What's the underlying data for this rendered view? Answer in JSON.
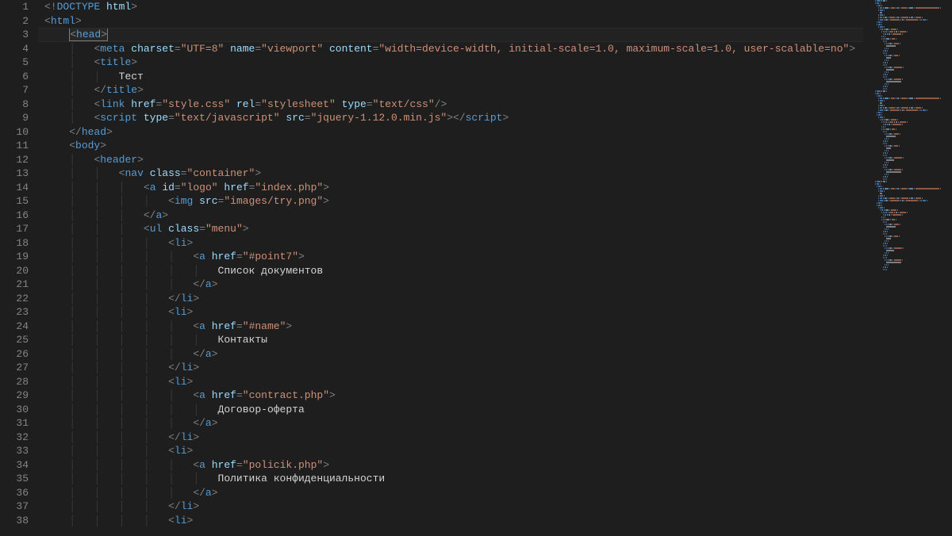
{
  "lineCount": 38,
  "highlightedLine": 3,
  "code": {
    "indentUnit": "    ",
    "lines": [
      {
        "n": 1,
        "indent": 0,
        "tokens": [
          {
            "t": "<!",
            "c": "pun"
          },
          {
            "t": "DOCTYPE",
            "c": "doctype"
          },
          {
            "t": " ",
            "c": "txt"
          },
          {
            "t": "html",
            "c": "attr"
          },
          {
            "t": ">",
            "c": "pun"
          }
        ]
      },
      {
        "n": 2,
        "indent": 0,
        "tokens": [
          {
            "t": "<",
            "c": "pun"
          },
          {
            "t": "html",
            "c": "tag"
          },
          {
            "t": ">",
            "c": "pun"
          }
        ]
      },
      {
        "n": 3,
        "indent": 1,
        "tokens": [
          {
            "t": "<",
            "c": "pun",
            "boxStart": true
          },
          {
            "t": "head",
            "c": "tag"
          },
          {
            "t": ">",
            "c": "pun",
            "boxEnd": true
          }
        ]
      },
      {
        "n": 4,
        "indent": 2,
        "tokens": [
          {
            "t": "<",
            "c": "pun"
          },
          {
            "t": "meta",
            "c": "tag"
          },
          {
            "t": " ",
            "c": "txt"
          },
          {
            "t": "charset",
            "c": "attr"
          },
          {
            "t": "=",
            "c": "pun"
          },
          {
            "t": "\"UTF=8\"",
            "c": "str"
          },
          {
            "t": " ",
            "c": "txt"
          },
          {
            "t": "name",
            "c": "attr"
          },
          {
            "t": "=",
            "c": "pun"
          },
          {
            "t": "\"viewport\"",
            "c": "str"
          },
          {
            "t": " ",
            "c": "txt"
          },
          {
            "t": "content",
            "c": "attr"
          },
          {
            "t": "=",
            "c": "pun"
          },
          {
            "t": "\"width=device-width, initial-scale=1.0, maximum-scale=1.0, user-scalable=no\"",
            "c": "str"
          },
          {
            "t": ">",
            "c": "pun"
          }
        ]
      },
      {
        "n": 5,
        "indent": 2,
        "tokens": [
          {
            "t": "<",
            "c": "pun"
          },
          {
            "t": "title",
            "c": "tag"
          },
          {
            "t": ">",
            "c": "pun"
          }
        ]
      },
      {
        "n": 6,
        "indent": 3,
        "tokens": [
          {
            "t": "Тест",
            "c": "txt"
          }
        ]
      },
      {
        "n": 7,
        "indent": 2,
        "tokens": [
          {
            "t": "</",
            "c": "pun"
          },
          {
            "t": "title",
            "c": "tag"
          },
          {
            "t": ">",
            "c": "pun"
          }
        ]
      },
      {
        "n": 8,
        "indent": 2,
        "tokens": [
          {
            "t": "<",
            "c": "pun"
          },
          {
            "t": "link",
            "c": "tag"
          },
          {
            "t": " ",
            "c": "txt"
          },
          {
            "t": "href",
            "c": "attr"
          },
          {
            "t": "=",
            "c": "pun"
          },
          {
            "t": "\"style.css\"",
            "c": "str"
          },
          {
            "t": " ",
            "c": "txt"
          },
          {
            "t": "rel",
            "c": "attr"
          },
          {
            "t": "=",
            "c": "pun"
          },
          {
            "t": "\"stylesheet\"",
            "c": "str"
          },
          {
            "t": " ",
            "c": "txt"
          },
          {
            "t": "type",
            "c": "attr"
          },
          {
            "t": "=",
            "c": "pun"
          },
          {
            "t": "\"text/css\"",
            "c": "str"
          },
          {
            "t": "/>",
            "c": "pun"
          }
        ]
      },
      {
        "n": 9,
        "indent": 2,
        "tokens": [
          {
            "t": "<",
            "c": "pun"
          },
          {
            "t": "script",
            "c": "tag"
          },
          {
            "t": " ",
            "c": "txt"
          },
          {
            "t": "type",
            "c": "attr"
          },
          {
            "t": "=",
            "c": "pun"
          },
          {
            "t": "\"text/javascript\"",
            "c": "str"
          },
          {
            "t": " ",
            "c": "txt"
          },
          {
            "t": "src",
            "c": "attr"
          },
          {
            "t": "=",
            "c": "pun"
          },
          {
            "t": "\"jquery-1.12.0.min.js\"",
            "c": "str"
          },
          {
            "t": ">",
            "c": "pun"
          },
          {
            "t": "</",
            "c": "pun"
          },
          {
            "t": "script",
            "c": "tag"
          },
          {
            "t": ">",
            "c": "pun"
          }
        ]
      },
      {
        "n": 10,
        "indent": 1,
        "tokens": [
          {
            "t": "</",
            "c": "pun"
          },
          {
            "t": "head",
            "c": "tag"
          },
          {
            "t": ">",
            "c": "pun"
          }
        ]
      },
      {
        "n": 11,
        "indent": 1,
        "tokens": [
          {
            "t": "<",
            "c": "pun"
          },
          {
            "t": "body",
            "c": "tag"
          },
          {
            "t": ">",
            "c": "pun"
          }
        ]
      },
      {
        "n": 12,
        "indent": 2,
        "tokens": [
          {
            "t": "<",
            "c": "pun"
          },
          {
            "t": "header",
            "c": "tag"
          },
          {
            "t": ">",
            "c": "pun"
          }
        ]
      },
      {
        "n": 13,
        "indent": 3,
        "tokens": [
          {
            "t": "<",
            "c": "pun"
          },
          {
            "t": "nav",
            "c": "tag"
          },
          {
            "t": " ",
            "c": "txt"
          },
          {
            "t": "class",
            "c": "attr"
          },
          {
            "t": "=",
            "c": "pun"
          },
          {
            "t": "\"container\"",
            "c": "str"
          },
          {
            "t": ">",
            "c": "pun"
          }
        ]
      },
      {
        "n": 14,
        "indent": 4,
        "tokens": [
          {
            "t": "<",
            "c": "pun"
          },
          {
            "t": "a",
            "c": "tag"
          },
          {
            "t": " ",
            "c": "txt"
          },
          {
            "t": "id",
            "c": "attr"
          },
          {
            "t": "=",
            "c": "pun"
          },
          {
            "t": "\"logo\"",
            "c": "str"
          },
          {
            "t": " ",
            "c": "txt"
          },
          {
            "t": "href",
            "c": "attr"
          },
          {
            "t": "=",
            "c": "pun"
          },
          {
            "t": "\"index.php\"",
            "c": "str"
          },
          {
            "t": ">",
            "c": "pun"
          }
        ]
      },
      {
        "n": 15,
        "indent": 5,
        "tokens": [
          {
            "t": "<",
            "c": "pun"
          },
          {
            "t": "img",
            "c": "tag"
          },
          {
            "t": " ",
            "c": "txt"
          },
          {
            "t": "src",
            "c": "attr"
          },
          {
            "t": "=",
            "c": "pun"
          },
          {
            "t": "\"images/try.png\"",
            "c": "str"
          },
          {
            "t": ">",
            "c": "pun"
          }
        ]
      },
      {
        "n": 16,
        "indent": 4,
        "tokens": [
          {
            "t": "</",
            "c": "pun"
          },
          {
            "t": "a",
            "c": "tag"
          },
          {
            "t": ">",
            "c": "pun"
          }
        ]
      },
      {
        "n": 17,
        "indent": 4,
        "tokens": [
          {
            "t": "<",
            "c": "pun"
          },
          {
            "t": "ul",
            "c": "tag"
          },
          {
            "t": " ",
            "c": "txt"
          },
          {
            "t": "class",
            "c": "attr"
          },
          {
            "t": "=",
            "c": "pun"
          },
          {
            "t": "\"menu\"",
            "c": "str"
          },
          {
            "t": ">",
            "c": "pun"
          }
        ]
      },
      {
        "n": 18,
        "indent": 5,
        "tokens": [
          {
            "t": "<",
            "c": "pun"
          },
          {
            "t": "li",
            "c": "tag"
          },
          {
            "t": ">",
            "c": "pun"
          }
        ]
      },
      {
        "n": 19,
        "indent": 6,
        "tokens": [
          {
            "t": "<",
            "c": "pun"
          },
          {
            "t": "a",
            "c": "tag"
          },
          {
            "t": " ",
            "c": "txt"
          },
          {
            "t": "href",
            "c": "attr"
          },
          {
            "t": "=",
            "c": "pun"
          },
          {
            "t": "\"#point7\"",
            "c": "str"
          },
          {
            "t": ">",
            "c": "pun"
          }
        ]
      },
      {
        "n": 20,
        "indent": 7,
        "tokens": [
          {
            "t": "Список документов",
            "c": "txt"
          }
        ]
      },
      {
        "n": 21,
        "indent": 6,
        "tokens": [
          {
            "t": "</",
            "c": "pun"
          },
          {
            "t": "a",
            "c": "tag"
          },
          {
            "t": ">",
            "c": "pun"
          }
        ]
      },
      {
        "n": 22,
        "indent": 5,
        "tokens": [
          {
            "t": "</",
            "c": "pun"
          },
          {
            "t": "li",
            "c": "tag"
          },
          {
            "t": ">",
            "c": "pun"
          }
        ]
      },
      {
        "n": 23,
        "indent": 5,
        "tokens": [
          {
            "t": "<",
            "c": "pun"
          },
          {
            "t": "li",
            "c": "tag"
          },
          {
            "t": ">",
            "c": "pun"
          }
        ]
      },
      {
        "n": 24,
        "indent": 6,
        "tokens": [
          {
            "t": "<",
            "c": "pun"
          },
          {
            "t": "a",
            "c": "tag"
          },
          {
            "t": " ",
            "c": "txt"
          },
          {
            "t": "href",
            "c": "attr"
          },
          {
            "t": "=",
            "c": "pun"
          },
          {
            "t": "\"#name\"",
            "c": "str"
          },
          {
            "t": ">",
            "c": "pun"
          }
        ]
      },
      {
        "n": 25,
        "indent": 7,
        "tokens": [
          {
            "t": "Контакты",
            "c": "txt"
          }
        ]
      },
      {
        "n": 26,
        "indent": 6,
        "tokens": [
          {
            "t": "</",
            "c": "pun"
          },
          {
            "t": "a",
            "c": "tag"
          },
          {
            "t": ">",
            "c": "pun"
          }
        ]
      },
      {
        "n": 27,
        "indent": 5,
        "tokens": [
          {
            "t": "</",
            "c": "pun"
          },
          {
            "t": "li",
            "c": "tag"
          },
          {
            "t": ">",
            "c": "pun"
          }
        ]
      },
      {
        "n": 28,
        "indent": 5,
        "tokens": [
          {
            "t": "<",
            "c": "pun"
          },
          {
            "t": "li",
            "c": "tag"
          },
          {
            "t": ">",
            "c": "pun"
          }
        ]
      },
      {
        "n": 29,
        "indent": 6,
        "tokens": [
          {
            "t": "<",
            "c": "pun"
          },
          {
            "t": "a",
            "c": "tag"
          },
          {
            "t": " ",
            "c": "txt"
          },
          {
            "t": "href",
            "c": "attr"
          },
          {
            "t": "=",
            "c": "pun"
          },
          {
            "t": "\"contract.php\"",
            "c": "str"
          },
          {
            "t": ">",
            "c": "pun"
          }
        ]
      },
      {
        "n": 30,
        "indent": 7,
        "tokens": [
          {
            "t": "Договор-оферта",
            "c": "txt"
          }
        ]
      },
      {
        "n": 31,
        "indent": 6,
        "tokens": [
          {
            "t": "</",
            "c": "pun"
          },
          {
            "t": "a",
            "c": "tag"
          },
          {
            "t": ">",
            "c": "pun"
          }
        ]
      },
      {
        "n": 32,
        "indent": 5,
        "tokens": [
          {
            "t": "</",
            "c": "pun"
          },
          {
            "t": "li",
            "c": "tag"
          },
          {
            "t": ">",
            "c": "pun"
          }
        ]
      },
      {
        "n": 33,
        "indent": 5,
        "tokens": [
          {
            "t": "<",
            "c": "pun"
          },
          {
            "t": "li",
            "c": "tag"
          },
          {
            "t": ">",
            "c": "pun"
          }
        ]
      },
      {
        "n": 34,
        "indent": 6,
        "tokens": [
          {
            "t": "<",
            "c": "pun"
          },
          {
            "t": "a",
            "c": "tag"
          },
          {
            "t": " ",
            "c": "txt"
          },
          {
            "t": "href",
            "c": "attr"
          },
          {
            "t": "=",
            "c": "pun"
          },
          {
            "t": "\"policik.php\"",
            "c": "str"
          },
          {
            "t": ">",
            "c": "pun"
          }
        ]
      },
      {
        "n": 35,
        "indent": 7,
        "tokens": [
          {
            "t": "Политика конфиденциальности",
            "c": "txt"
          }
        ]
      },
      {
        "n": 36,
        "indent": 6,
        "tokens": [
          {
            "t": "</",
            "c": "pun"
          },
          {
            "t": "a",
            "c": "tag"
          },
          {
            "t": ">",
            "c": "pun"
          }
        ]
      },
      {
        "n": 37,
        "indent": 5,
        "tokens": [
          {
            "t": "</",
            "c": "pun"
          },
          {
            "t": "li",
            "c": "tag"
          },
          {
            "t": ">",
            "c": "pun"
          }
        ]
      },
      {
        "n": 38,
        "indent": 5,
        "tokens": [
          {
            "t": "<",
            "c": "pun"
          },
          {
            "t": "li",
            "c": "tag"
          },
          {
            "t": ">",
            "c": "pun"
          }
        ]
      }
    ]
  },
  "minimapColors": {
    "pun": "#556070",
    "tag": "#3a6ea5",
    "doctype": "#3a6ea5",
    "attr": "#5f86a8",
    "str": "#8a5a44",
    "txt": "#7d7d7d"
  }
}
